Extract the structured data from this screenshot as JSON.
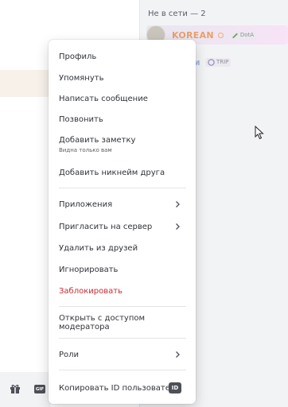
{
  "members_panel": {
    "section_header": "Не в сети — 2",
    "members": [
      {
        "name": "KOREAN",
        "activity": "DotA"
      },
      {
        "name": "шери",
        "activity": "TRIP"
      }
    ]
  },
  "context_menu": {
    "items": [
      {
        "label": "Профиль"
      },
      {
        "label": "Упомянуть"
      },
      {
        "label": "Написать сообщение"
      },
      {
        "label": "Позвонить"
      },
      {
        "label": "Добавить заметку",
        "sublabel": "Видна только вам"
      },
      {
        "label": "Добавить никнейм друга"
      },
      {
        "label": "Приложения"
      },
      {
        "label": "Пригласить на сервер"
      },
      {
        "label": "Удалить из друзей"
      },
      {
        "label": "Игнорировать"
      },
      {
        "label": "Заблокировать"
      },
      {
        "label": "Открыть с доступом модератора"
      },
      {
        "label": "Роли"
      },
      {
        "label": "Копировать ID пользователя",
        "badge": "ID"
      }
    ]
  },
  "chat_bar": {
    "gif_label": "GIF"
  },
  "colors": {
    "danger": "#c92b34",
    "korean_name": "#e9a06a",
    "sheri_name": "#a6b7df"
  }
}
